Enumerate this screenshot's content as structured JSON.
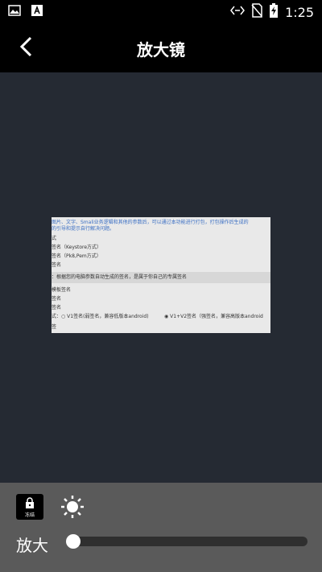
{
  "status_bar": {
    "time": "1:25",
    "left_icons": [
      "image-icon",
      "text-font-icon"
    ],
    "right_icons": [
      "data-sync-icon",
      "no-sim-icon",
      "battery-charging-icon"
    ]
  },
  "header": {
    "title": "放大镜",
    "back_icon": "chevron-left-icon"
  },
  "preview": {
    "lines": [
      "图片、文字、Smali业务逻辑和其他的参数后，可以通过本功能进行打包，打包操作后生成的",
      "的引导和提示自行解决问题。",
      "式",
      "签名（Keystore方式）",
      "签名（Pk8,Pem方式）",
      "签名",
      "：根据您的电脑参数自动生成的签名，是属于你自己的专属签名",
      "模板签名",
      "签名",
      "签名",
      "式：",
      "V1签名(弱签名，兼容低版本android)",
      "V1+V2签名（强签名，兼容高版本android",
      "签"
    ]
  },
  "controls": {
    "freeze_label": "冻结",
    "freeze_icon": "lock-icon",
    "brightness_icon": "sun-icon",
    "zoom_label": "放大",
    "zoom_value_fraction": 0.0
  },
  "colors": {
    "viewer_bg": "#252a33",
    "control_bg": "#5a5a5a",
    "accent_link": "#3b6fc4"
  }
}
